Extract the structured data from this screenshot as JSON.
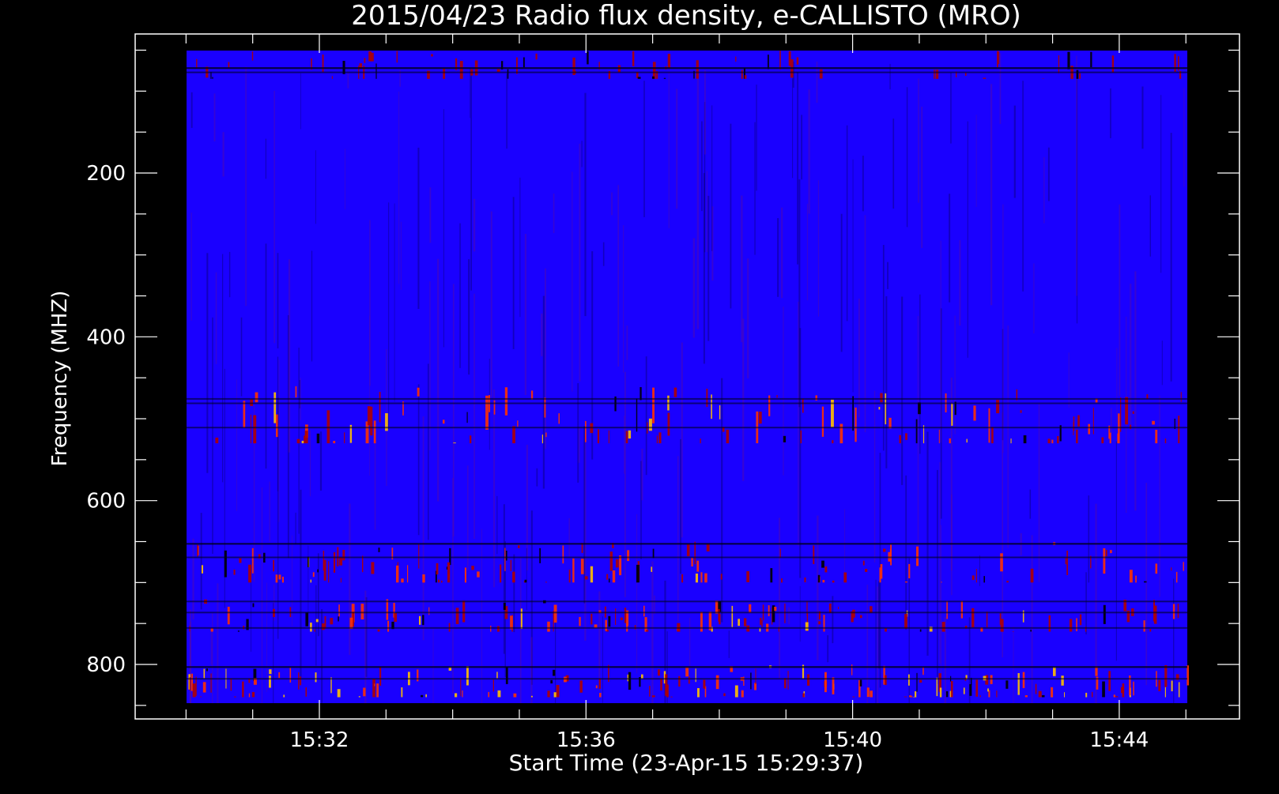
{
  "chart_data": {
    "type": "heatmap",
    "title": "2015/04/23  Radio flux density, e-CALLISTO (MRO)",
    "xlabel": "Start Time (23-Apr-15 15:29:37)",
    "ylabel": "Frequency (MHZ)",
    "x_ticks": [
      "15:32",
      "15:36",
      "15:40",
      "15:44"
    ],
    "y_ticks": [
      200,
      400,
      600,
      800
    ],
    "y_axis_inverted": true,
    "colormap": [
      "#000000",
      "#1a00ff",
      "#b00000",
      "#ff3000",
      "#ffc000",
      "#ffff80"
    ],
    "background": "#000000",
    "axis_color": "#ffffff",
    "intense_bands_mhz": [
      {
        "from": 460,
        "to": 530,
        "level": "strong"
      },
      {
        "from": 650,
        "to": 700,
        "level": "strong"
      },
      {
        "from": 720,
        "to": 760,
        "level": "strong"
      },
      {
        "from": 800,
        "to": 840,
        "level": "very strong"
      },
      {
        "from": 45,
        "to": 85,
        "level": "moderate"
      }
    ]
  }
}
